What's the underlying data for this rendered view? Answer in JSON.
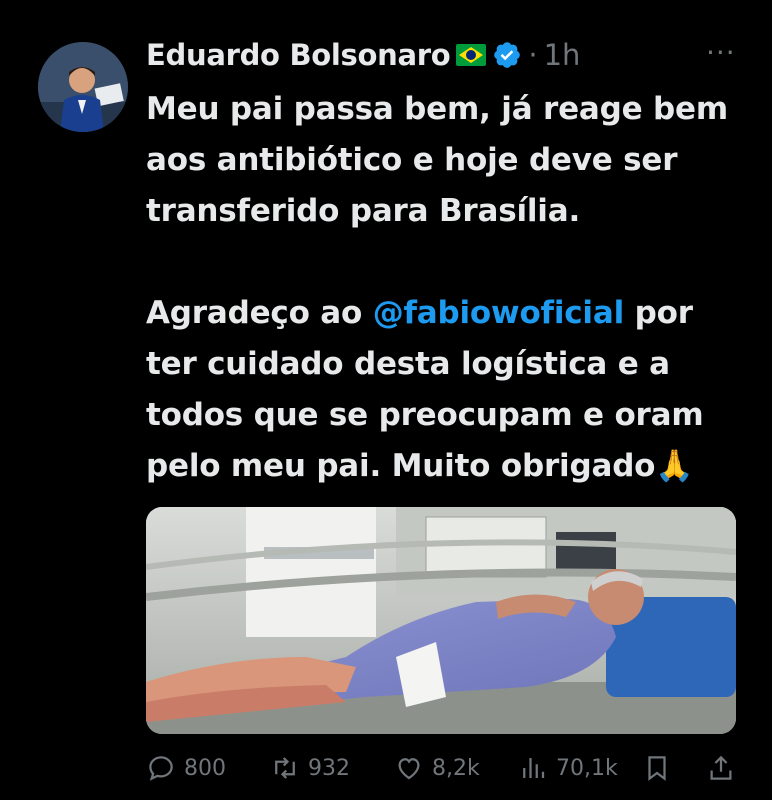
{
  "post": {
    "author_name": "Eduardo Bolsonaro",
    "author_flag": "brazil-flag-icon",
    "verified": true,
    "separator": "·",
    "time": "1h",
    "more_label": "···",
    "text_para1": "Meu pai passa bem, já reage bem aos antibiótico e hoje deve ser transferido para Brasília.",
    "text_para2_before": "Agradeço ao ",
    "mention": "@fabiowoficial",
    "text_para2_after": " por ter cuidado desta logística e a todos que se preocupam e oram pelo meu pai. Muito obrigado",
    "emoji": "🙏"
  },
  "actions": {
    "replies": "800",
    "reposts": "932",
    "likes": "8,2k",
    "views": "70,1k"
  },
  "colors": {
    "background": "#000000",
    "text": "#e7e9ea",
    "muted": "#71767b",
    "accent": "#1d9bf0"
  }
}
